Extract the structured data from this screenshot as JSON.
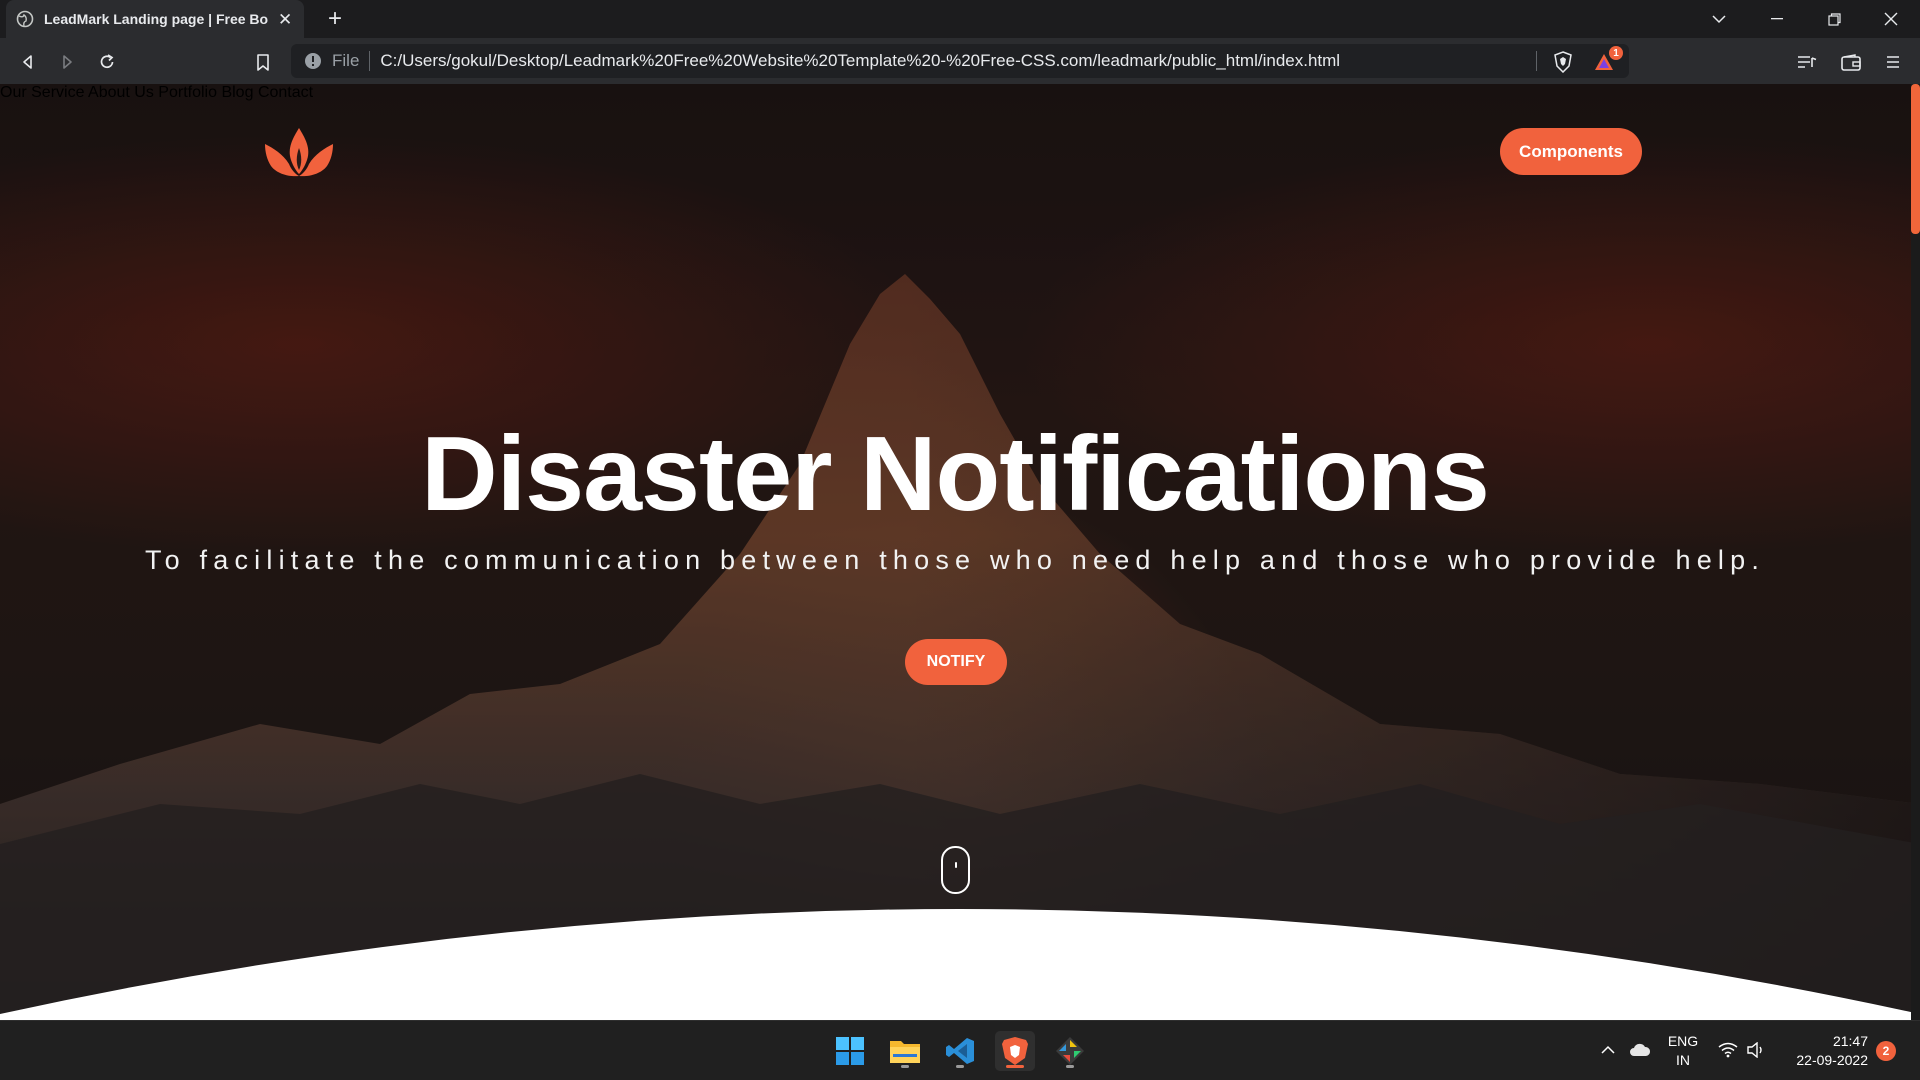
{
  "browser": {
    "tab_title": "LeadMark Landing page | Free Bo",
    "url_scheme": "File",
    "url": "C:/Users/gokul/Desktop/Leadmark%20Free%20Website%20Template%20-%20Free-CSS.com/leadmark/public_html/index.html",
    "shield_badge": "1"
  },
  "page": {
    "nav": {
      "items": [
        "Our Service",
        "About Us",
        "Portfolio",
        "Blog",
        "Contact"
      ],
      "cta": "Components"
    },
    "hero": {
      "title": "Disaster Notifications",
      "subtitle": "To facilitate the communication between those who need help and those who provide help.",
      "button": "NOTIFY"
    },
    "accent_color": "#f1623d"
  },
  "taskbar": {
    "language": "ENG",
    "region": "IN",
    "time": "21:47",
    "date": "22-09-2022",
    "notification_count": "2"
  }
}
